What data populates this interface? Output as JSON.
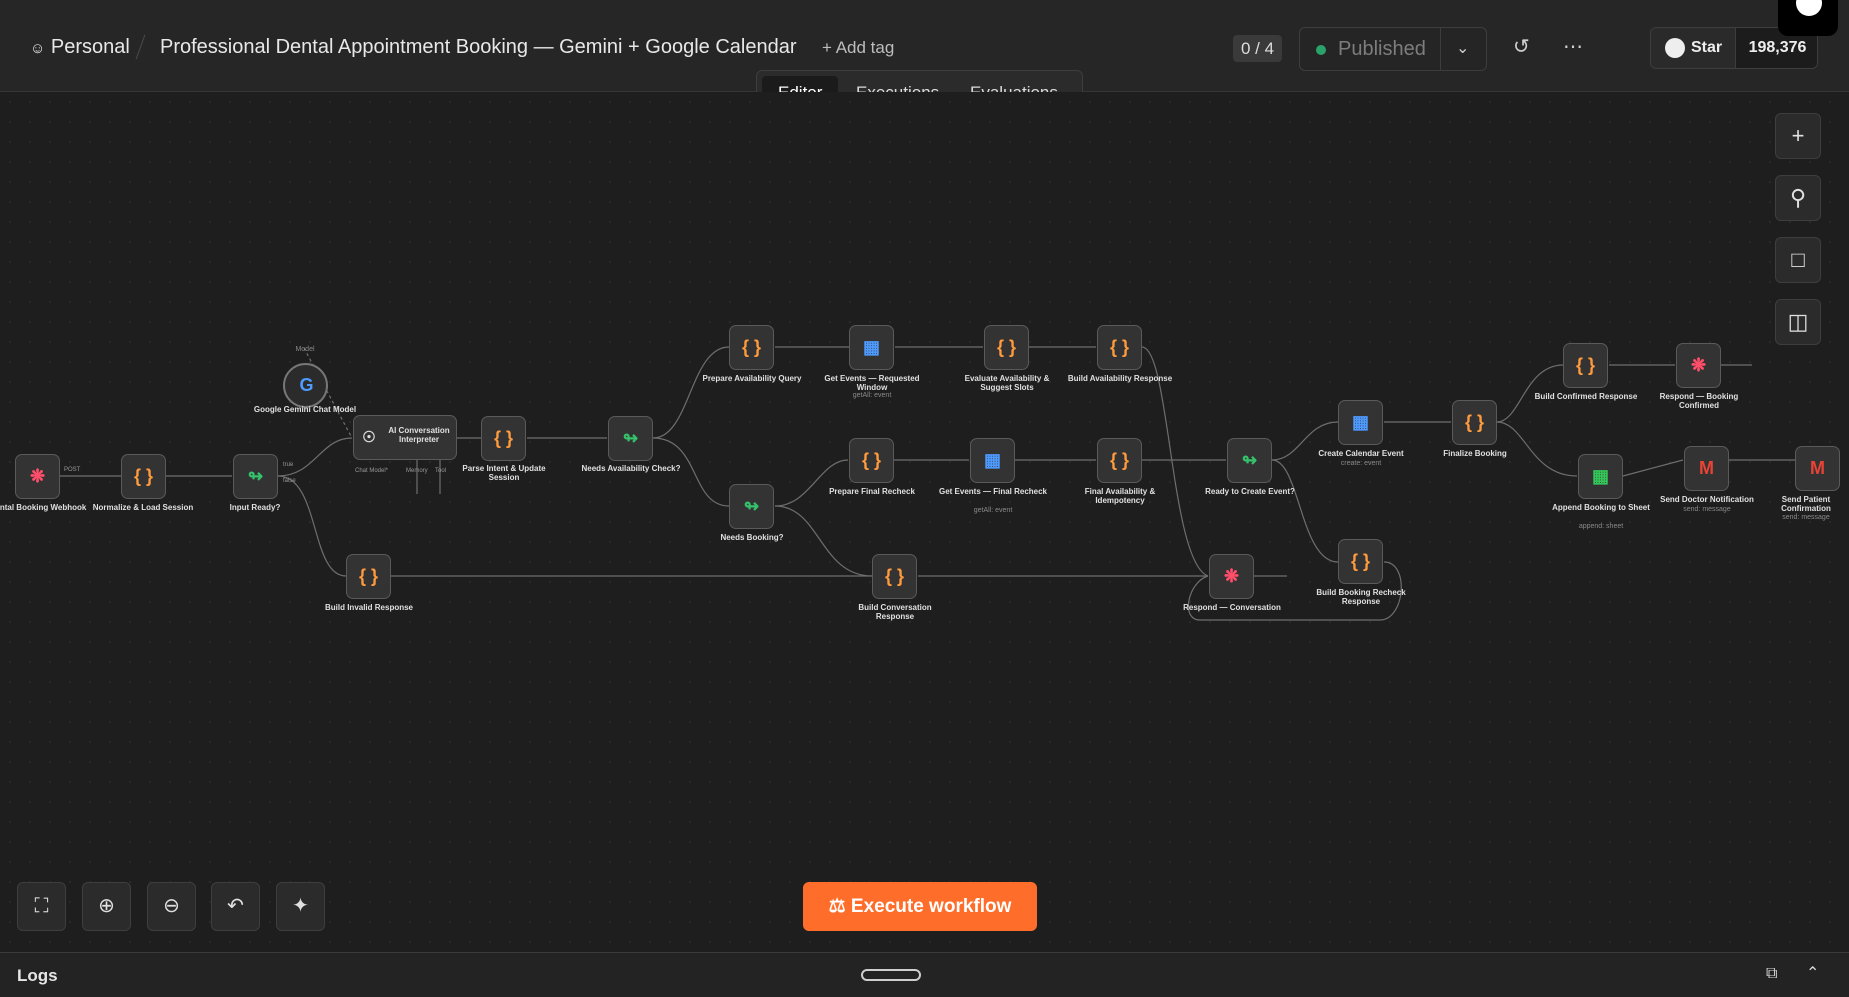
{
  "header": {
    "project": "Personal",
    "workflow_title": "Professional Dental Appointment Booking — Gemini + Google Calendar",
    "add_tag": "+ Add tag",
    "counter": "0 / 4",
    "status": "Published",
    "github_star": "Star",
    "github_count": "198,376"
  },
  "tabs": [
    "Editor",
    "Executions",
    "Evaluations"
  ],
  "execute_label": "Execute workflow",
  "logs_label": "Logs",
  "colors": {
    "accent": "#ff6d2a",
    "published_dot": "#29a36a",
    "code": "#ff9b3d",
    "if": "#35c26b",
    "webhook": "#ff4d6a"
  },
  "nodes": {
    "webhook": {
      "label": "Dental Booking Webhook",
      "port": "POST"
    },
    "normalize": {
      "label": "Normalize & Load Session"
    },
    "input_ready": {
      "label": "Input Ready?"
    },
    "gemini": {
      "label": "Google Gemini Chat Model",
      "top": "Model"
    },
    "agent": {
      "label": "AI Conversation Interpreter",
      "p1": "Chat Model*",
      "p2": "Memory",
      "p3": "Tool"
    },
    "parse": {
      "label": "Parse Intent & Update Session"
    },
    "needs_avail": {
      "label": "Needs Availability Check?"
    },
    "prep_avail": {
      "label": "Prepare Availability Query"
    },
    "get_events": {
      "label": "Get Events — Requested Window",
      "sub": "getAll: event"
    },
    "evaluate": {
      "label": "Evaluate Availability & Suggest Slots"
    },
    "build_avail": {
      "label": "Build Availability Response"
    },
    "needs_booking": {
      "label": "Needs Booking?"
    },
    "prep_final": {
      "label": "Prepare Final Recheck"
    },
    "get_final": {
      "label": "Get Events — Final Recheck",
      "sub": "getAll: event"
    },
    "final_avail": {
      "label": "Final Availability & Idempotency"
    },
    "ready_create": {
      "label": "Ready to Create Event?"
    },
    "create_event": {
      "label": "Create Calendar Event",
      "sub": "create: event"
    },
    "finalize": {
      "label": "Finalize Booking"
    },
    "build_confirmed": {
      "label": "Build Confirmed Response"
    },
    "respond_confirmed": {
      "label": "Respond — Booking Confirmed"
    },
    "append_sheet": {
      "label": "Append Booking to Sheet",
      "sub": "append: sheet"
    },
    "send_doctor": {
      "label": "Send Doctor Notification",
      "sub": "send: message"
    },
    "send_patient": {
      "label": "Send Patient Confirmation",
      "sub": "send: message"
    },
    "build_invalid": {
      "label": "Build Invalid Response"
    },
    "build_conv": {
      "label": "Build Conversation Response"
    },
    "respond_conv": {
      "label": "Respond — Conversation"
    },
    "build_recheck": {
      "label": "Build Booking Recheck Response"
    },
    "if_true": "true",
    "if_false": "false"
  }
}
